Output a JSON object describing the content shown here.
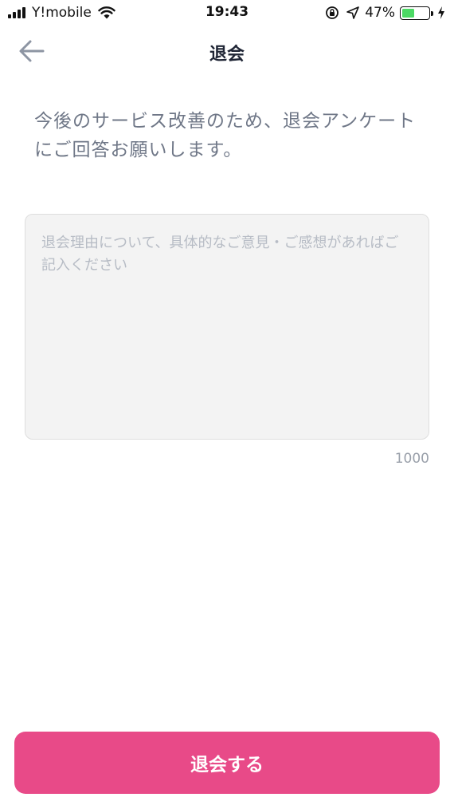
{
  "status_bar": {
    "carrier": "Y!mobile",
    "time": "19:43",
    "battery_percent": "47%",
    "battery_level": 0.47,
    "icons": [
      "signal-icon",
      "wifi-icon",
      "orientation-lock-icon",
      "location-icon",
      "battery-icon",
      "charging-icon"
    ]
  },
  "nav": {
    "title": "退会",
    "back_icon": "arrow-left-icon"
  },
  "intro_text": "今後のサービス改善のため、退会アンケートにご回答お願いします。",
  "feedback": {
    "placeholder": "退会理由について、具体的なご意見・ご感想があればご記入ください",
    "value": "",
    "max_length": "1000"
  },
  "submit": {
    "label": "退会する"
  },
  "colors": {
    "primary": "#e84a88",
    "title": "#1f2535",
    "body_text": "#6f7787",
    "placeholder": "#b7bcc5",
    "input_bg": "#f3f3f3",
    "battery": "#4cd964"
  }
}
